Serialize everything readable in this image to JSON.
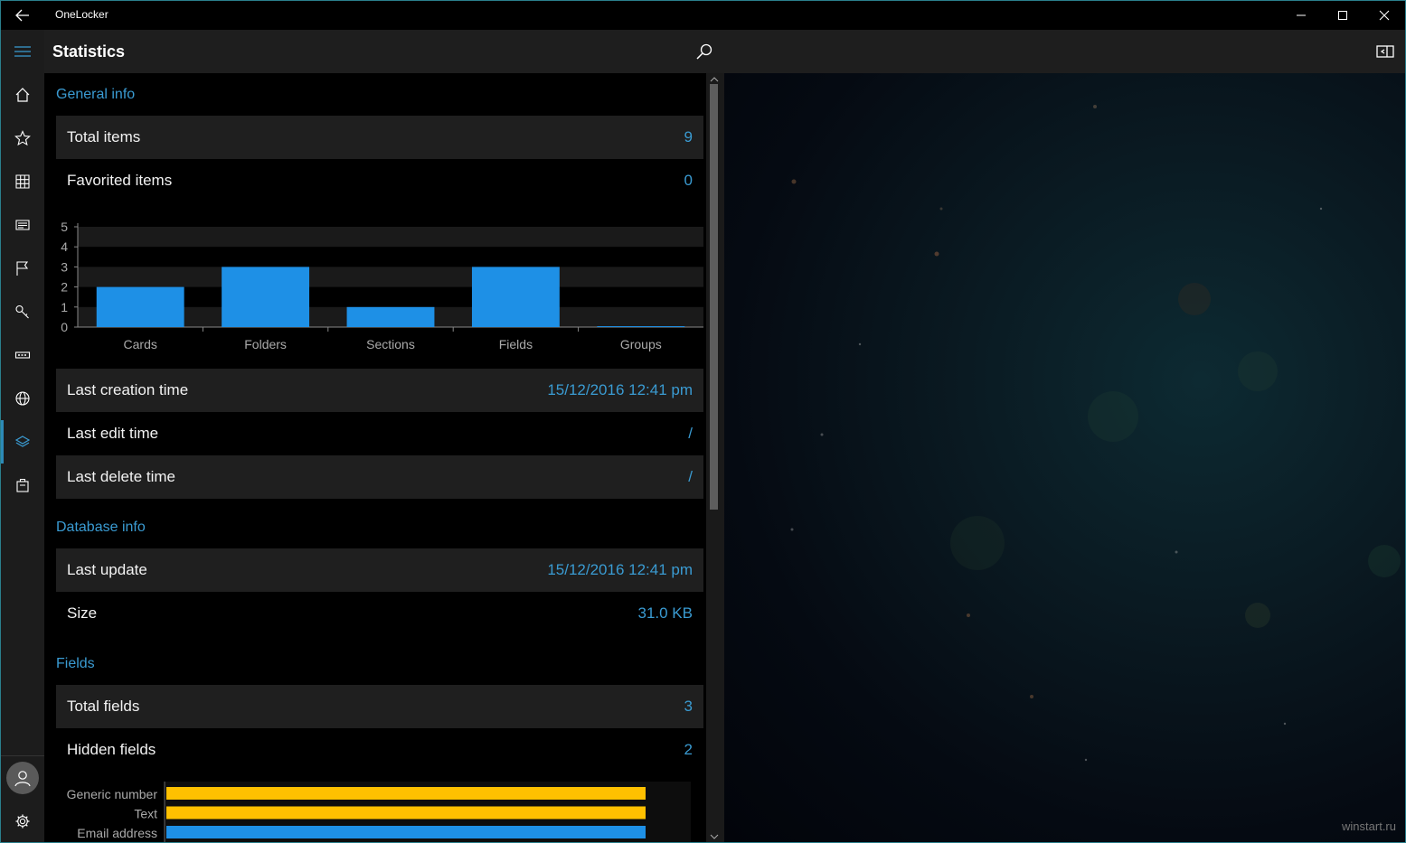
{
  "app": {
    "title": "OneLocker"
  },
  "header": {
    "title": "Statistics"
  },
  "nav": {
    "items": [
      {
        "icon": "menu-icon"
      },
      {
        "icon": "home-icon"
      },
      {
        "icon": "star-icon"
      },
      {
        "icon": "grid-icon"
      },
      {
        "icon": "card-icon"
      },
      {
        "icon": "flag-icon"
      },
      {
        "icon": "key-icon"
      },
      {
        "icon": "password-icon"
      },
      {
        "icon": "globe-icon"
      },
      {
        "icon": "layers-icon",
        "active": true
      },
      {
        "icon": "briefcase-icon"
      }
    ]
  },
  "general": {
    "title": "General info",
    "total_items_label": "Total items",
    "total_items_value": "9",
    "favorited_label": "Favorited items",
    "favorited_value": "0",
    "last_creation_label": "Last creation time",
    "last_creation_value": "15/12/2016 12:41 pm",
    "last_edit_label": "Last edit time",
    "last_edit_value": "/",
    "last_delete_label": "Last delete time",
    "last_delete_value": "/"
  },
  "database": {
    "title": "Database info",
    "last_update_label": "Last update",
    "last_update_value": "15/12/2016 12:41 pm",
    "size_label": "Size",
    "size_value": "31.0 KB"
  },
  "fields": {
    "title": "Fields",
    "total_label": "Total fields",
    "total_value": "3",
    "hidden_label": "Hidden fields",
    "hidden_value": "2"
  },
  "watermark": "winstart.ru",
  "colors": {
    "accent": "#3a9bd2",
    "bar_blue": "#1e90e6",
    "bar_yellow": "#ffc000"
  },
  "chart_data": [
    {
      "type": "bar",
      "categories": [
        "Cards",
        "Folders",
        "Sections",
        "Fields",
        "Groups"
      ],
      "values": [
        2,
        3,
        1,
        3,
        0
      ],
      "ylim": [
        0,
        5
      ],
      "yticks": [
        "0",
        "1",
        "2",
        "3",
        "4",
        "5"
      ],
      "grid": true
    },
    {
      "type": "bar",
      "orientation": "horizontal",
      "categories": [
        "Generic number",
        "Text",
        "Email address"
      ],
      "values": [
        1,
        1,
        1
      ],
      "colors": [
        "#ffc000",
        "#ffc000",
        "#1e90e6"
      ]
    }
  ]
}
